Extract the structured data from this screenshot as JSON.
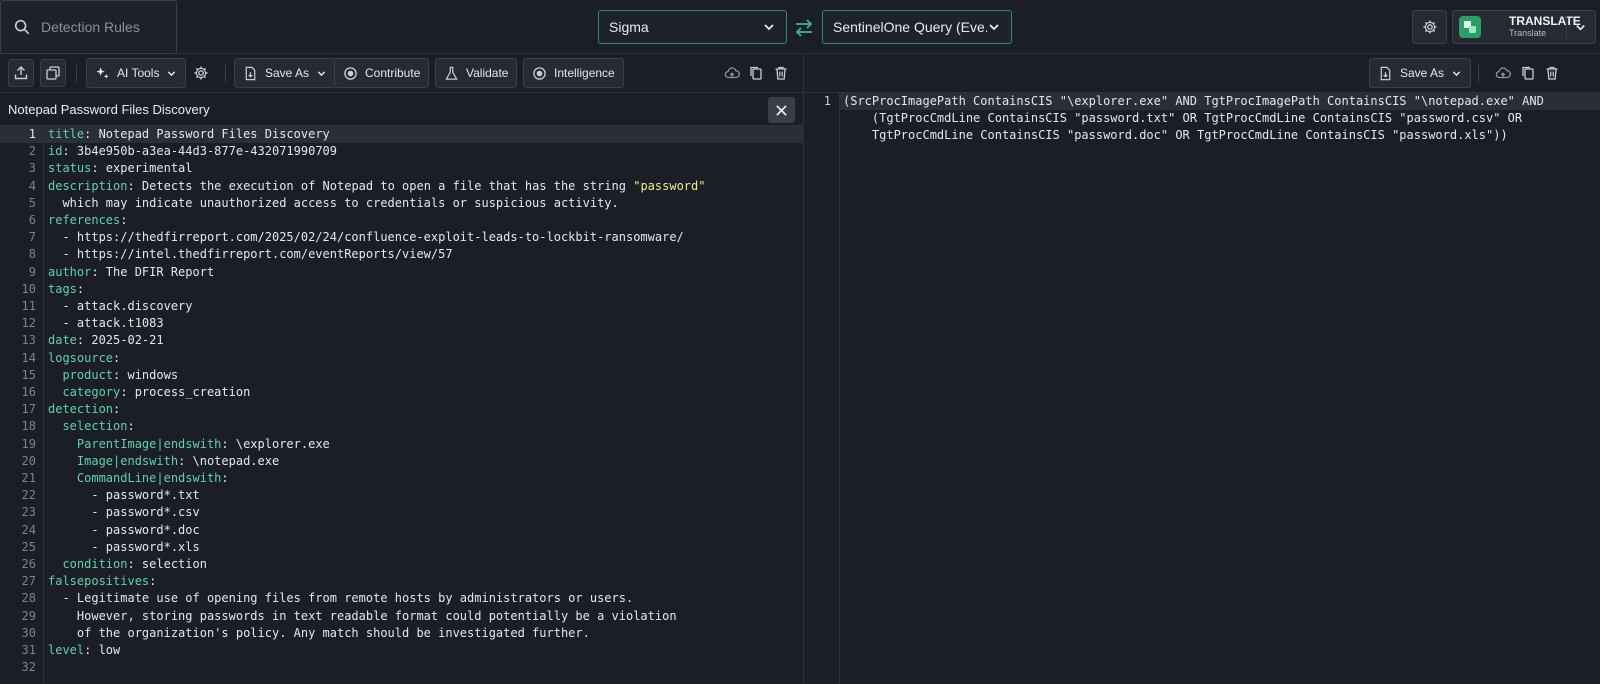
{
  "search": {
    "placeholder": "Detection Rules"
  },
  "languages": {
    "source": "Sigma",
    "target": "SentinelOne Query (Eve..."
  },
  "translate": {
    "title": "TRANSLATE",
    "subtitle": "Translate"
  },
  "left_toolbar": {
    "ai_tools": "AI Tools",
    "save_as": "Save As",
    "contribute": "Contribute",
    "validate": "Validate",
    "intelligence": "Intelligence"
  },
  "right_toolbar": {
    "save_as": "Save As"
  },
  "rule": {
    "title": "Notepad Password Files Discovery"
  },
  "source_lines": [
    [
      [
        "k",
        "title"
      ],
      [
        "t",
        ": Notepad Password Files Discovery"
      ]
    ],
    [
      [
        "k",
        "id"
      ],
      [
        "t",
        ": 3b4e950b-a3ea-44d3-877e-432071990709"
      ]
    ],
    [
      [
        "k",
        "status"
      ],
      [
        "t",
        ": experimental"
      ]
    ],
    [
      [
        "k",
        "description"
      ],
      [
        "t",
        ": Detects the execution of Notepad to open a file that has the string "
      ],
      [
        "s",
        "\"password\""
      ]
    ],
    [
      [
        "t",
        "  which may indicate unauthorized access to credentials or suspicious activity."
      ]
    ],
    [
      [
        "k",
        "references"
      ],
      [
        "t",
        ":"
      ]
    ],
    [
      [
        "t",
        "  - https://thedfirreport.com/2025/02/24/confluence-exploit-leads-to-lockbit-ransomware/"
      ]
    ],
    [
      [
        "t",
        "  - https://intel.thedfirreport.com/eventReports/view/57"
      ]
    ],
    [
      [
        "k",
        "author"
      ],
      [
        "t",
        ": The DFIR Report"
      ]
    ],
    [
      [
        "k",
        "tags"
      ],
      [
        "t",
        ":"
      ]
    ],
    [
      [
        "t",
        "  - attack.discovery"
      ]
    ],
    [
      [
        "t",
        "  - attack.t1083"
      ]
    ],
    [
      [
        "k",
        "date"
      ],
      [
        "t",
        ": 2025-02-21"
      ]
    ],
    [
      [
        "k",
        "logsource"
      ],
      [
        "t",
        ":"
      ]
    ],
    [
      [
        "t",
        "  "
      ],
      [
        "k",
        "product"
      ],
      [
        "t",
        ": windows"
      ]
    ],
    [
      [
        "t",
        "  "
      ],
      [
        "k",
        "category"
      ],
      [
        "t",
        ": process_creation"
      ]
    ],
    [
      [
        "k",
        "detection"
      ],
      [
        "t",
        ":"
      ]
    ],
    [
      [
        "t",
        "  "
      ],
      [
        "k",
        "selection"
      ],
      [
        "t",
        ":"
      ]
    ],
    [
      [
        "t",
        "    "
      ],
      [
        "k",
        "ParentImage|endswith"
      ],
      [
        "t",
        ": \\explorer.exe"
      ]
    ],
    [
      [
        "t",
        "    "
      ],
      [
        "k",
        "Image|endswith"
      ],
      [
        "t",
        ": \\notepad.exe"
      ]
    ],
    [
      [
        "t",
        "    "
      ],
      [
        "k",
        "CommandLine|endswith"
      ],
      [
        "t",
        ":"
      ]
    ],
    [
      [
        "t",
        "      - password*.txt"
      ]
    ],
    [
      [
        "t",
        "      - password*.csv"
      ]
    ],
    [
      [
        "t",
        "      - password*.doc"
      ]
    ],
    [
      [
        "t",
        "      - password*.xls"
      ]
    ],
    [
      [
        "t",
        "  "
      ],
      [
        "k",
        "condition"
      ],
      [
        "t",
        ": selection"
      ]
    ],
    [
      [
        "k",
        "falsepositives"
      ],
      [
        "t",
        ":"
      ]
    ],
    [
      [
        "t",
        "  - Legitimate use of opening files from remote hosts by administrators or users."
      ]
    ],
    [
      [
        "t",
        "    However, storing passwords in text readable format could potentially be a violation"
      ]
    ],
    [
      [
        "t",
        "    of the organization's policy. Any match should be investigated further."
      ]
    ],
    [
      [
        "k",
        "level"
      ],
      [
        "t",
        ": low"
      ]
    ],
    [
      [
        "t",
        ""
      ]
    ]
  ],
  "output_line_number": "1",
  "output_lines": [
    "(SrcProcImagePath ContainsCIS \"\\explorer.exe\" AND TgtProcImagePath ContainsCIS \"\\notepad.exe\" AND",
    "    (TgtProcCmdLine ContainsCIS \"password.txt\" OR TgtProcCmdLine ContainsCIS \"password.csv\" OR",
    "    TgtProcCmdLine ContainsCIS \"password.doc\" OR TgtProcCmdLine ContainsCIS \"password.xls\"))"
  ],
  "colors": {
    "accent": "#2f8a74",
    "key": "#5fd3a8",
    "string": "#f2e98a",
    "background": "#1b1e27"
  }
}
